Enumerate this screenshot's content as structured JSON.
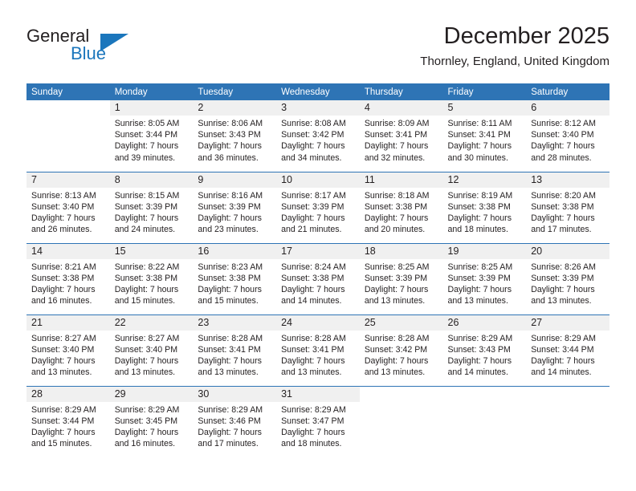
{
  "brand": {
    "name_part1": "General",
    "name_part2": "Blue",
    "accent_color": "#1b76bc"
  },
  "header": {
    "month_title": "December 2025",
    "location": "Thornley, England, United Kingdom"
  },
  "calendar": {
    "header_bg": "#2e74b5",
    "daynum_bg": "#f0f0f0",
    "weekday_headers": [
      "Sunday",
      "Monday",
      "Tuesday",
      "Wednesday",
      "Thursday",
      "Friday",
      "Saturday"
    ],
    "weeks": [
      [
        {
          "day": "",
          "sunrise": "",
          "sunset": "",
          "daylight1": "",
          "daylight2": ""
        },
        {
          "day": "1",
          "sunrise": "Sunrise: 8:05 AM",
          "sunset": "Sunset: 3:44 PM",
          "daylight1": "Daylight: 7 hours",
          "daylight2": "and 39 minutes."
        },
        {
          "day": "2",
          "sunrise": "Sunrise: 8:06 AM",
          "sunset": "Sunset: 3:43 PM",
          "daylight1": "Daylight: 7 hours",
          "daylight2": "and 36 minutes."
        },
        {
          "day": "3",
          "sunrise": "Sunrise: 8:08 AM",
          "sunset": "Sunset: 3:42 PM",
          "daylight1": "Daylight: 7 hours",
          "daylight2": "and 34 minutes."
        },
        {
          "day": "4",
          "sunrise": "Sunrise: 8:09 AM",
          "sunset": "Sunset: 3:41 PM",
          "daylight1": "Daylight: 7 hours",
          "daylight2": "and 32 minutes."
        },
        {
          "day": "5",
          "sunrise": "Sunrise: 8:11 AM",
          "sunset": "Sunset: 3:41 PM",
          "daylight1": "Daylight: 7 hours",
          "daylight2": "and 30 minutes."
        },
        {
          "day": "6",
          "sunrise": "Sunrise: 8:12 AM",
          "sunset": "Sunset: 3:40 PM",
          "daylight1": "Daylight: 7 hours",
          "daylight2": "and 28 minutes."
        }
      ],
      [
        {
          "day": "7",
          "sunrise": "Sunrise: 8:13 AM",
          "sunset": "Sunset: 3:40 PM",
          "daylight1": "Daylight: 7 hours",
          "daylight2": "and 26 minutes."
        },
        {
          "day": "8",
          "sunrise": "Sunrise: 8:15 AM",
          "sunset": "Sunset: 3:39 PM",
          "daylight1": "Daylight: 7 hours",
          "daylight2": "and 24 minutes."
        },
        {
          "day": "9",
          "sunrise": "Sunrise: 8:16 AM",
          "sunset": "Sunset: 3:39 PM",
          "daylight1": "Daylight: 7 hours",
          "daylight2": "and 23 minutes."
        },
        {
          "day": "10",
          "sunrise": "Sunrise: 8:17 AM",
          "sunset": "Sunset: 3:39 PM",
          "daylight1": "Daylight: 7 hours",
          "daylight2": "and 21 minutes."
        },
        {
          "day": "11",
          "sunrise": "Sunrise: 8:18 AM",
          "sunset": "Sunset: 3:38 PM",
          "daylight1": "Daylight: 7 hours",
          "daylight2": "and 20 minutes."
        },
        {
          "day": "12",
          "sunrise": "Sunrise: 8:19 AM",
          "sunset": "Sunset: 3:38 PM",
          "daylight1": "Daylight: 7 hours",
          "daylight2": "and 18 minutes."
        },
        {
          "day": "13",
          "sunrise": "Sunrise: 8:20 AM",
          "sunset": "Sunset: 3:38 PM",
          "daylight1": "Daylight: 7 hours",
          "daylight2": "and 17 minutes."
        }
      ],
      [
        {
          "day": "14",
          "sunrise": "Sunrise: 8:21 AM",
          "sunset": "Sunset: 3:38 PM",
          "daylight1": "Daylight: 7 hours",
          "daylight2": "and 16 minutes."
        },
        {
          "day": "15",
          "sunrise": "Sunrise: 8:22 AM",
          "sunset": "Sunset: 3:38 PM",
          "daylight1": "Daylight: 7 hours",
          "daylight2": "and 15 minutes."
        },
        {
          "day": "16",
          "sunrise": "Sunrise: 8:23 AM",
          "sunset": "Sunset: 3:38 PM",
          "daylight1": "Daylight: 7 hours",
          "daylight2": "and 15 minutes."
        },
        {
          "day": "17",
          "sunrise": "Sunrise: 8:24 AM",
          "sunset": "Sunset: 3:38 PM",
          "daylight1": "Daylight: 7 hours",
          "daylight2": "and 14 minutes."
        },
        {
          "day": "18",
          "sunrise": "Sunrise: 8:25 AM",
          "sunset": "Sunset: 3:39 PM",
          "daylight1": "Daylight: 7 hours",
          "daylight2": "and 13 minutes."
        },
        {
          "day": "19",
          "sunrise": "Sunrise: 8:25 AM",
          "sunset": "Sunset: 3:39 PM",
          "daylight1": "Daylight: 7 hours",
          "daylight2": "and 13 minutes."
        },
        {
          "day": "20",
          "sunrise": "Sunrise: 8:26 AM",
          "sunset": "Sunset: 3:39 PM",
          "daylight1": "Daylight: 7 hours",
          "daylight2": "and 13 minutes."
        }
      ],
      [
        {
          "day": "21",
          "sunrise": "Sunrise: 8:27 AM",
          "sunset": "Sunset: 3:40 PM",
          "daylight1": "Daylight: 7 hours",
          "daylight2": "and 13 minutes."
        },
        {
          "day": "22",
          "sunrise": "Sunrise: 8:27 AM",
          "sunset": "Sunset: 3:40 PM",
          "daylight1": "Daylight: 7 hours",
          "daylight2": "and 13 minutes."
        },
        {
          "day": "23",
          "sunrise": "Sunrise: 8:28 AM",
          "sunset": "Sunset: 3:41 PM",
          "daylight1": "Daylight: 7 hours",
          "daylight2": "and 13 minutes."
        },
        {
          "day": "24",
          "sunrise": "Sunrise: 8:28 AM",
          "sunset": "Sunset: 3:41 PM",
          "daylight1": "Daylight: 7 hours",
          "daylight2": "and 13 minutes."
        },
        {
          "day": "25",
          "sunrise": "Sunrise: 8:28 AM",
          "sunset": "Sunset: 3:42 PM",
          "daylight1": "Daylight: 7 hours",
          "daylight2": "and 13 minutes."
        },
        {
          "day": "26",
          "sunrise": "Sunrise: 8:29 AM",
          "sunset": "Sunset: 3:43 PM",
          "daylight1": "Daylight: 7 hours",
          "daylight2": "and 14 minutes."
        },
        {
          "day": "27",
          "sunrise": "Sunrise: 8:29 AM",
          "sunset": "Sunset: 3:44 PM",
          "daylight1": "Daylight: 7 hours",
          "daylight2": "and 14 minutes."
        }
      ],
      [
        {
          "day": "28",
          "sunrise": "Sunrise: 8:29 AM",
          "sunset": "Sunset: 3:44 PM",
          "daylight1": "Daylight: 7 hours",
          "daylight2": "and 15 minutes."
        },
        {
          "day": "29",
          "sunrise": "Sunrise: 8:29 AM",
          "sunset": "Sunset: 3:45 PM",
          "daylight1": "Daylight: 7 hours",
          "daylight2": "and 16 minutes."
        },
        {
          "day": "30",
          "sunrise": "Sunrise: 8:29 AM",
          "sunset": "Sunset: 3:46 PM",
          "daylight1": "Daylight: 7 hours",
          "daylight2": "and 17 minutes."
        },
        {
          "day": "31",
          "sunrise": "Sunrise: 8:29 AM",
          "sunset": "Sunset: 3:47 PM",
          "daylight1": "Daylight: 7 hours",
          "daylight2": "and 18 minutes."
        },
        {
          "day": "",
          "sunrise": "",
          "sunset": "",
          "daylight1": "",
          "daylight2": ""
        },
        {
          "day": "",
          "sunrise": "",
          "sunset": "",
          "daylight1": "",
          "daylight2": ""
        },
        {
          "day": "",
          "sunrise": "",
          "sunset": "",
          "daylight1": "",
          "daylight2": ""
        }
      ]
    ]
  }
}
